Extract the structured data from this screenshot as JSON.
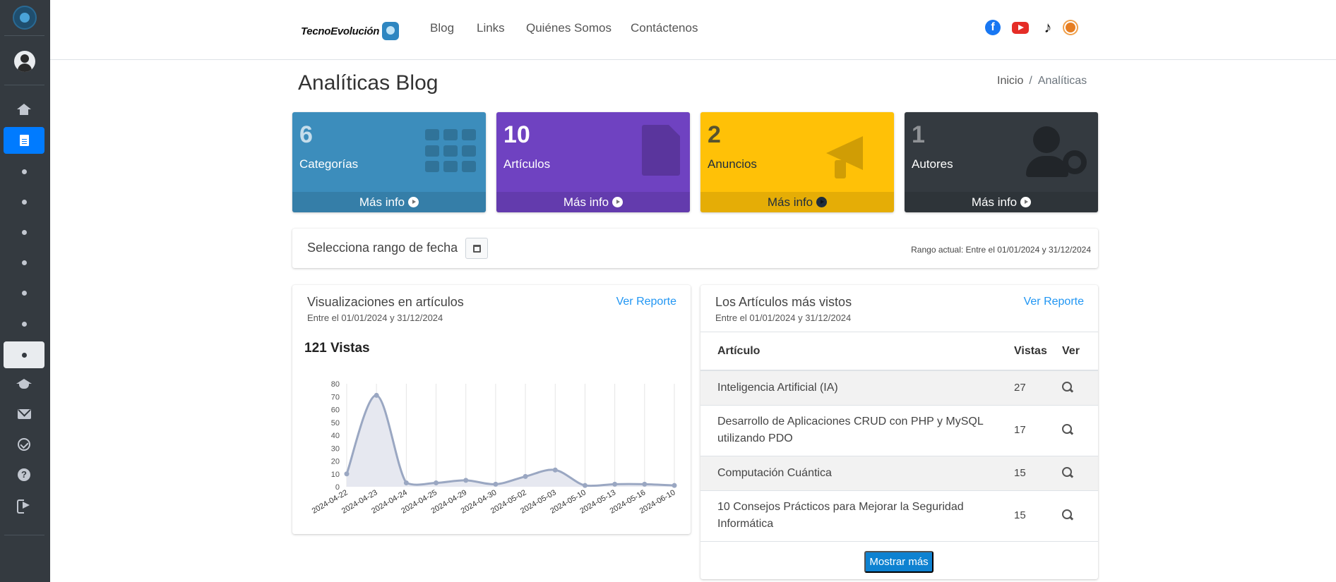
{
  "brand": {
    "name": "TecnoEvolución"
  },
  "nav": {
    "links": [
      "Blog",
      "Links",
      "Quiénes Somos",
      "Contáctenos"
    ],
    "social_icons": [
      "facebook-icon",
      "youtube-icon",
      "tiktok-icon",
      "theme-sun-icon"
    ]
  },
  "sidebar": {
    "items": [
      {
        "icon": "home-icon",
        "active": false
      },
      {
        "icon": "document-icon",
        "active": true
      },
      {
        "icon": "dot-icon",
        "active": false
      },
      {
        "icon": "dot-icon",
        "active": false
      },
      {
        "icon": "dot-icon",
        "active": false
      },
      {
        "icon": "dot-icon",
        "active": false
      },
      {
        "icon": "dot-icon",
        "active": false
      },
      {
        "icon": "dot-icon",
        "active": false
      },
      {
        "icon": "dot-icon",
        "active": "light"
      },
      {
        "icon": "graduation-cap-icon",
        "active": false
      },
      {
        "icon": "envelope-icon",
        "active": false
      },
      {
        "icon": "check-circle-icon",
        "active": false
      },
      {
        "icon": "question-circle-icon",
        "active": false
      },
      {
        "icon": "sign-out-icon",
        "active": false
      }
    ]
  },
  "page": {
    "title": "Analíticas Blog",
    "breadcrumb": [
      "Inicio",
      "Analíticas"
    ],
    "breadcrumb_sep": "/"
  },
  "boxes": [
    {
      "value": "6",
      "label": "Categorías",
      "more": "Más info",
      "color": "#3c8dbc",
      "icon": "th-icon"
    },
    {
      "value": "10",
      "label": "Artículos",
      "more": "Más info",
      "color": "#6f42c1",
      "icon": "file-icon"
    },
    {
      "value": "2",
      "label": "Anuncios",
      "more": "Más info",
      "color": "#ffc107",
      "icon": "bullhorn-icon"
    },
    {
      "value": "1",
      "label": "Autores",
      "more": "Más info",
      "color": "#343a40",
      "icon": "users-cog-icon"
    }
  ],
  "date_range": {
    "label": "Selecciona rango de fecha",
    "current": "Rango actual: Entre el 01/01/2024 y 31/12/2024"
  },
  "views_card": {
    "title": "Visualizaciones en artículos",
    "subtitle": "Entre el 01/01/2024 y 31/12/2024",
    "link": "Ver Reporte",
    "total": "121 Vistas"
  },
  "chart_data": {
    "type": "area",
    "x": [
      "2024-04-22",
      "2024-04-23",
      "2024-04-24",
      "2024-04-25",
      "2024-04-29",
      "2024-04-30",
      "2024-05-02",
      "2024-05-03",
      "2024-05-10",
      "2024-05-13",
      "2024-05-16",
      "2024-06-10"
    ],
    "values": [
      10,
      71,
      3,
      3,
      5,
      2,
      8,
      13,
      1,
      2,
      2,
      1
    ],
    "yticks": [
      0,
      10,
      20,
      30,
      40,
      50,
      60,
      70,
      80
    ],
    "ylim": [
      0,
      80
    ],
    "grid": "vertical",
    "fill_color": "#e6e8f0",
    "line_color": "#9aa7c2"
  },
  "top_card": {
    "title": "Los Artículos más vistos",
    "subtitle": "Entre el 01/01/2024 y 31/12/2024",
    "link": "Ver Reporte",
    "columns": [
      "Artículo",
      "Vistas",
      "Ver"
    ],
    "rows": [
      {
        "title": "Inteligencia Artificial (IA)",
        "views": "27"
      },
      {
        "title": "Desarrollo de Aplicaciones CRUD con PHP y MySQL utilizando PDO",
        "views": "17"
      },
      {
        "title": "Computación Cuántica",
        "views": "15"
      },
      {
        "title": "10 Consejos Prácticos para Mejorar la Seguridad Informática",
        "views": "15"
      }
    ],
    "more_button": "Mostrar más"
  }
}
